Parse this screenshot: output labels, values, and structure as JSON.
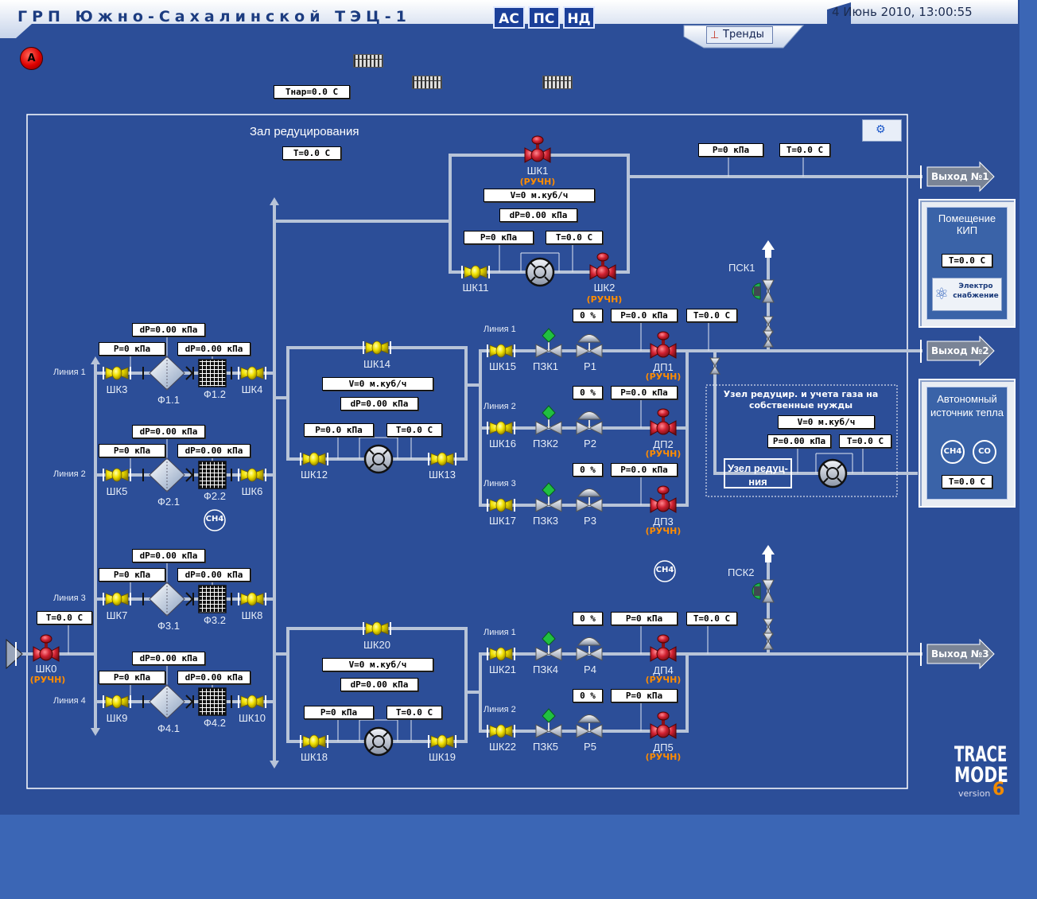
{
  "header": {
    "title": "ГРП Южно-Сахалинской ТЭЦ-1",
    "datetime": "4 Июнь 2010, 13:00:55",
    "modes": [
      "АС",
      "ПС",
      "НД"
    ],
    "trends_label": "Тренды",
    "alarm": "A"
  },
  "tnar": "Tнар=0.0 C",
  "hall": {
    "title": "Зал редуцирования",
    "temp": "T=0.0 C"
  },
  "colors": {
    "background": "#2c4e98",
    "pipe": "#b8c4d8",
    "manual": "#ff8c00",
    "valve_red": "#d02030",
    "valve_yellow": "#f0e000",
    "valve_green": "#20c040"
  },
  "top_block": {
    "shk1": "ШК1",
    "shk1_mode": "(РУЧН)",
    "flow": "V=0 м.куб/ч",
    "dp": "dP=0.00 кПа",
    "p": "P=0 кПа",
    "t": "T=0.0 C",
    "shk11": "ШК11",
    "shk2": "ШК2",
    "shk2_mode": "(РУЧН)",
    "out_p": "P=0 кПа",
    "out_t": "T=0.0 C"
  },
  "inlet": {
    "temp": "T=0.0 C",
    "shk0": "ШК0",
    "mode": "(РУЧН)"
  },
  "filter_lines": [
    {
      "line": "Линия 1",
      "dp_top": "dP=0.00 кПа",
      "p": "P=0 кПа",
      "dp": "dP=0.00 кПа",
      "v_in": "ШК3",
      "f1": "Ф1.1",
      "f2": "Ф1.2",
      "v_out": "ШК4"
    },
    {
      "line": "Линия 2",
      "dp_top": "dP=0.00 кПа",
      "p": "P=0 кПа",
      "dp": "dP=0.00 кПа",
      "v_in": "ШК5",
      "f1": "Ф2.1",
      "f2": "Ф2.2",
      "v_out": "ШК6"
    },
    {
      "line": "Линия 3",
      "dp_top": "dP=0.00 кПа",
      "p": "P=0 кПа",
      "dp": "dP=0.00 кПа",
      "v_in": "ШК7",
      "f1": "Ф3.1",
      "f2": "Ф3.2",
      "v_out": "ШК8"
    },
    {
      "line": "Линия 4",
      "dp_top": "dP=0.00 кПа",
      "p": "P=0 кПа",
      "dp": "dP=0.00 кПа",
      "v_in": "ШК9",
      "f1": "Ф4.1",
      "f2": "Ф4.2",
      "v_out": "ШК10"
    }
  ],
  "ch4_left": "CH4",
  "ch4_mid": "CH4",
  "meter_upper": {
    "bypass": "ШК14",
    "flow": "V=0 м.куб/ч",
    "dp": "dP=0.00 кПа",
    "p": "P=0.0 кПа",
    "t": "T=0.0 C",
    "v_in": "ШК12",
    "v_out": "ШК13"
  },
  "meter_lower": {
    "bypass": "ШК20",
    "flow": "V=0 м.куб/ч",
    "dp": "dP=0.00 кПа",
    "p": "P=0 кПа",
    "t": "T=0.0 C",
    "v_in": "ШК18",
    "v_out": "ШК19"
  },
  "reg_lines": [
    {
      "line": "Линия 1",
      "pct": "0 %",
      "p": "P=0.0 кПа",
      "t": "T=0.0 C",
      "shk": "ШК15",
      "pzk": "ПЗК1",
      "r": "Р1",
      "dp": "ДП1",
      "mode": "(РУЧН)"
    },
    {
      "line": "Линия 2",
      "pct": "0 %",
      "p": "P=0.0 кПа",
      "t": "",
      "shk": "ШК16",
      "pzk": "ПЗК2",
      "r": "Р2",
      "dp": "ДП2",
      "mode": "(РУЧН)"
    },
    {
      "line": "Линия 3",
      "pct": "0 %",
      "p": "P=0.0 кПа",
      "t": "",
      "shk": "ШК17",
      "pzk": "ПЗК3",
      "r": "Р3",
      "dp": "ДП3",
      "mode": "(РУЧН)"
    },
    {
      "line": "Линия 1",
      "pct": "0 %",
      "p": "P=0 кПа",
      "t": "T=0.0 C",
      "shk": "ШК21",
      "pzk": "ПЗК4",
      "r": "Р4",
      "dp": "ДП4",
      "mode": "(РУЧН)"
    },
    {
      "line": "Линия 2",
      "pct": "0 %",
      "p": "P=0 кПа",
      "t": "",
      "shk": "ШК22",
      "pzk": "ПЗК5",
      "r": "Р5",
      "dp": "ДП5",
      "mode": "(РУЧН)"
    }
  ],
  "psk1": "ПСК1",
  "psk2": "ПСК2",
  "own_needs": {
    "title": "Узел редуцир. и учета газа на собственные нужды",
    "flow": "V=0 м.куб/ч",
    "p": "P=0.00 кПа",
    "t": "T=0.0 C",
    "node": "Узел редуц-ния"
  },
  "exits": [
    "Выход №1",
    "Выход №2",
    "Выход №3"
  ],
  "kip_panel": {
    "title": "Помещение КИП",
    "temp": "T=0.0 C",
    "power": "Электро снабжение"
  },
  "heat_panel": {
    "title": "Автономный источник тепла",
    "ch4": "CH4",
    "co": "CO",
    "temp": "T=0.0 C"
  },
  "watermark": {
    "line1": "TRACE",
    "line2": "MODE",
    "version": "version",
    "num": "6"
  }
}
